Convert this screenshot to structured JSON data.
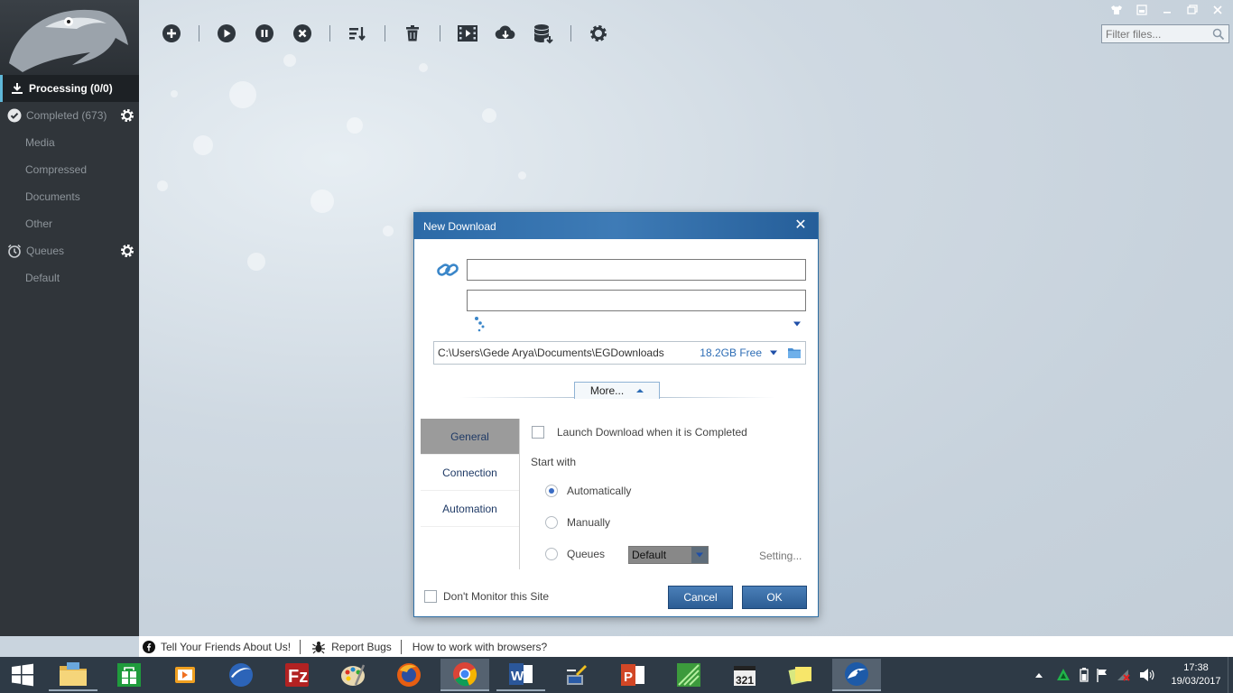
{
  "sidebar": {
    "processing": "Processing (0/0)",
    "completed": "Completed (673)",
    "categories": [
      "Media",
      "Compressed",
      "Documents",
      "Other"
    ],
    "queues": "Queues",
    "queue_items": [
      "Default"
    ]
  },
  "toolbar": {
    "icons": [
      "add-icon",
      "play-icon",
      "pause-icon",
      "stop-icon",
      "sort-icon",
      "trash-icon",
      "video-icon",
      "cloud-download-icon",
      "database-icon",
      "gear-icon"
    ]
  },
  "filter": {
    "placeholder": "Filter files..."
  },
  "dialog": {
    "title": "New Download",
    "path": "C:\\Users\\Gede Arya\\Documents\\EGDownloads",
    "free": "18.2GB Free",
    "more": "More...",
    "tabs": [
      "General",
      "Connection",
      "Automation"
    ],
    "launch_label": "Launch Download when it is Completed",
    "start_with": "Start with",
    "radio_auto": "Automatically",
    "radio_manual": "Manually",
    "radio_queues": "Queues",
    "queue_value": "Default",
    "setting": "Setting...",
    "dont_monitor": "Don't Monitor this Site",
    "cancel": "Cancel",
    "ok": "OK"
  },
  "statusbar": {
    "friends": "Tell Your Friends About Us!",
    "bugs": "Report Bugs",
    "browsers": "How to work with browsers?"
  },
  "taskbar": {
    "apps": [
      "file-explorer-icon",
      "store-icon",
      "media-player-icon",
      "browser-icon",
      "filezilla-icon",
      "paint-icon",
      "firefox-icon",
      "chrome-icon",
      "word-icon",
      "network-tool-icon",
      "powerpoint-icon",
      "app-icon",
      "mpc-icon",
      "sticky-notes-icon",
      "eagleget-icon"
    ],
    "time": "17:38",
    "date": "19/03/2017"
  },
  "colors": {
    "accent": "#2c6aa7",
    "sidebar": "#30353a",
    "taskbar": "#2e3a46"
  }
}
